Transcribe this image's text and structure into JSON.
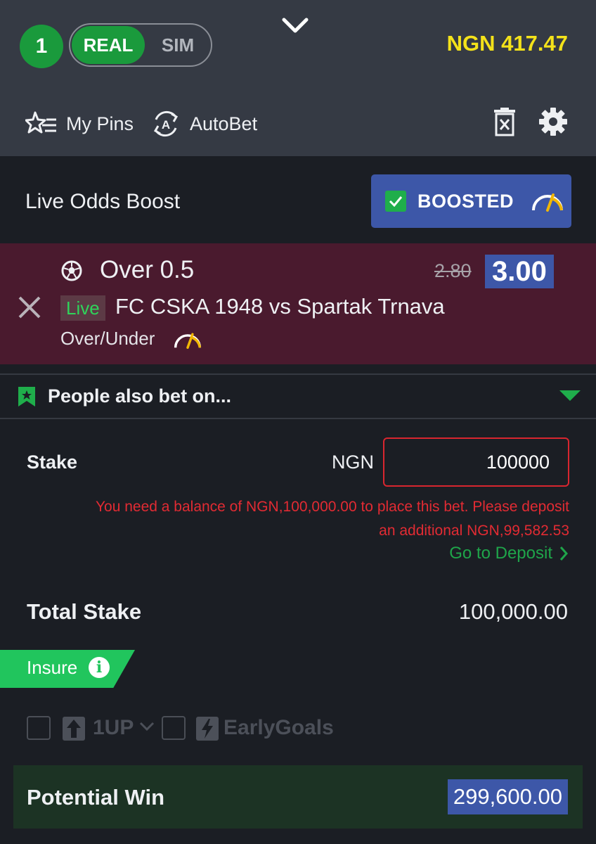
{
  "header": {
    "selection_count": "1",
    "mode_real": "REAL",
    "mode_sim": "SIM",
    "balance": "NGN 417.47",
    "my_pins_label": "My Pins",
    "autobet_label": "AutoBet"
  },
  "boost": {
    "label": "Live Odds Boost",
    "button_label": "BOOSTED"
  },
  "selection": {
    "market": "Over 0.5",
    "old_odds": "2.80",
    "new_odds": "3.00",
    "live_badge": "Live",
    "match": "FC CSKA 1948 vs Spartak Trnava",
    "bet_type": "Over/Under"
  },
  "people_also_bet": {
    "label": "People also bet on..."
  },
  "stake": {
    "label": "Stake",
    "currency": "NGN",
    "value": "100000",
    "error_line1": "You need a balance of NGN,100,000.00 to place this bet. Please deposit",
    "error_line2": "an additional NGN,99,582.53",
    "deposit_link": "Go to Deposit"
  },
  "total": {
    "label": "Total Stake",
    "value": "100,000.00"
  },
  "insure": {
    "label": "Insure",
    "info": "i"
  },
  "options": {
    "one_up": "1UP",
    "early_goals": "EarlyGoals"
  },
  "potential_win": {
    "label": "Potential Win",
    "value": "299,600.00"
  },
  "colors": {
    "accent_green": "#1a9a3c",
    "balance_yellow": "#f4e21a",
    "boost_blue": "#3d57a8",
    "selection_bg": "#4a1a2e",
    "error_red": "#e22b33",
    "win_bg": "#1c3324"
  }
}
